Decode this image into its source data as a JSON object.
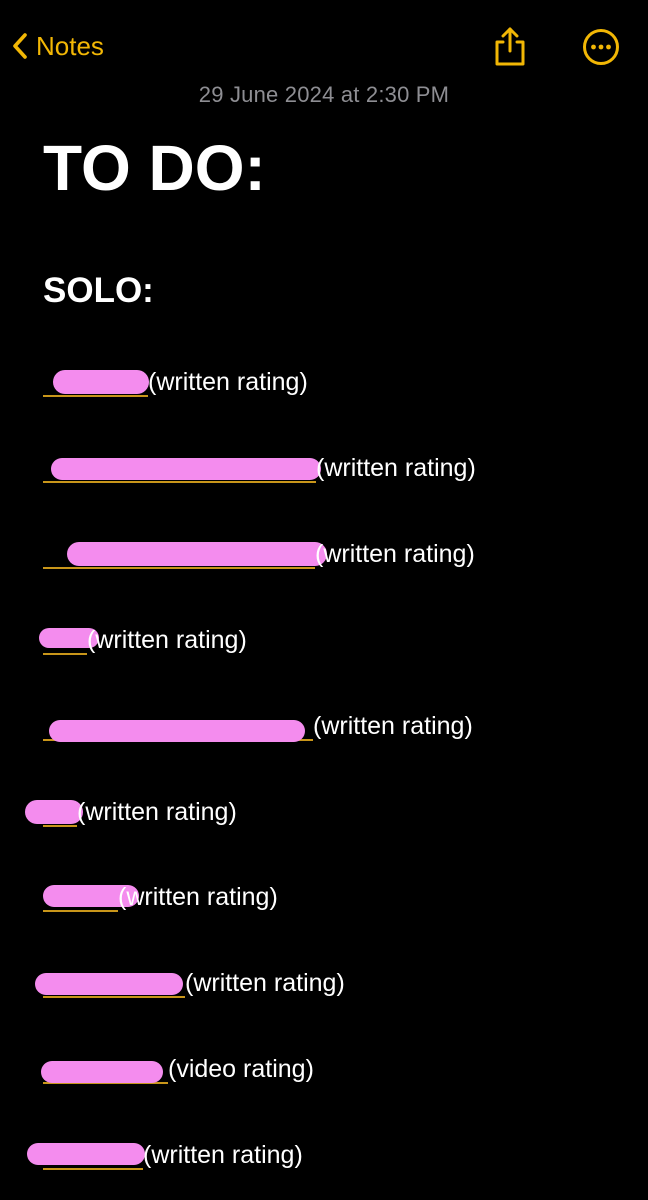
{
  "nav": {
    "back_label": "Notes",
    "accent_color": "#f2b705",
    "share_icon": "share-icon",
    "more_icon": "ellipsis-circle-icon"
  },
  "note": {
    "date": "29 June 2024 at 2:30 PM",
    "title": "TO DO:",
    "section_heading": "SOLO:",
    "redaction_color": "#f48cee",
    "items": [
      {
        "name_visible": false,
        "rating": "(written rating)"
      },
      {
        "name_visible": false,
        "rating": "(written rating)"
      },
      {
        "name_visible": false,
        "rating": "(written rating)"
      },
      {
        "name_visible": false,
        "rating": "(written rating)"
      },
      {
        "name_visible": false,
        "rating": "(written rating)"
      },
      {
        "name_visible": false,
        "rating": "(written rating)"
      },
      {
        "name_visible": false,
        "rating": "(written rating)"
      },
      {
        "name_visible": false,
        "rating": "(written rating)"
      },
      {
        "name_visible": false,
        "rating": "(video rating)"
      },
      {
        "name_visible": false,
        "rating": "(written rating)"
      }
    ]
  }
}
